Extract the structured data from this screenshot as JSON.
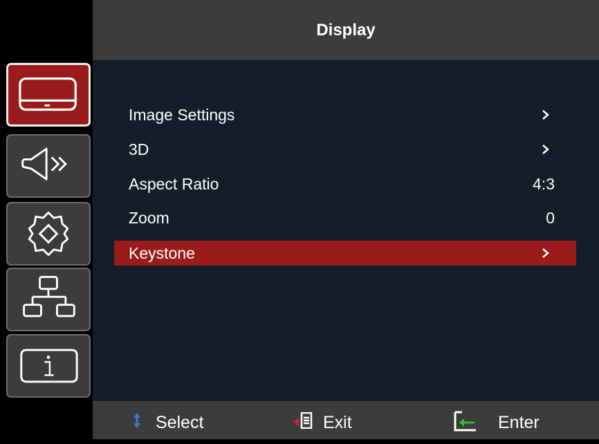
{
  "header": {
    "title": "Display"
  },
  "sidebar": {
    "tabs": [
      {
        "icon": "display-icon",
        "active": true
      },
      {
        "icon": "audio-icon",
        "active": false
      },
      {
        "icon": "settings-gear-icon",
        "active": false
      },
      {
        "icon": "network-icon",
        "active": false
      },
      {
        "icon": "info-icon",
        "active": false
      }
    ]
  },
  "menu": {
    "items": [
      {
        "label": "Image Settings",
        "value": "",
        "submenu": true,
        "selected": false
      },
      {
        "label": "3D",
        "value": "",
        "submenu": true,
        "selected": false
      },
      {
        "label": "Aspect Ratio",
        "value": "4:3",
        "submenu": false,
        "selected": false
      },
      {
        "label": "Zoom",
        "value": "0",
        "submenu": false,
        "selected": false
      },
      {
        "label": "Keystone",
        "value": "",
        "submenu": true,
        "selected": true
      }
    ]
  },
  "footer": {
    "select_label": "Select",
    "exit_label": "Exit",
    "enter_label": "Enter"
  },
  "colors": {
    "accent_red": "#9a1b1b",
    "panel_gray": "#3c3c3c",
    "content_bg": "#141d28",
    "exit_arrow_red": "#d0202a",
    "enter_arrow_green": "#2fbf3a",
    "select_arrow_blue": "#3a7bd5"
  }
}
